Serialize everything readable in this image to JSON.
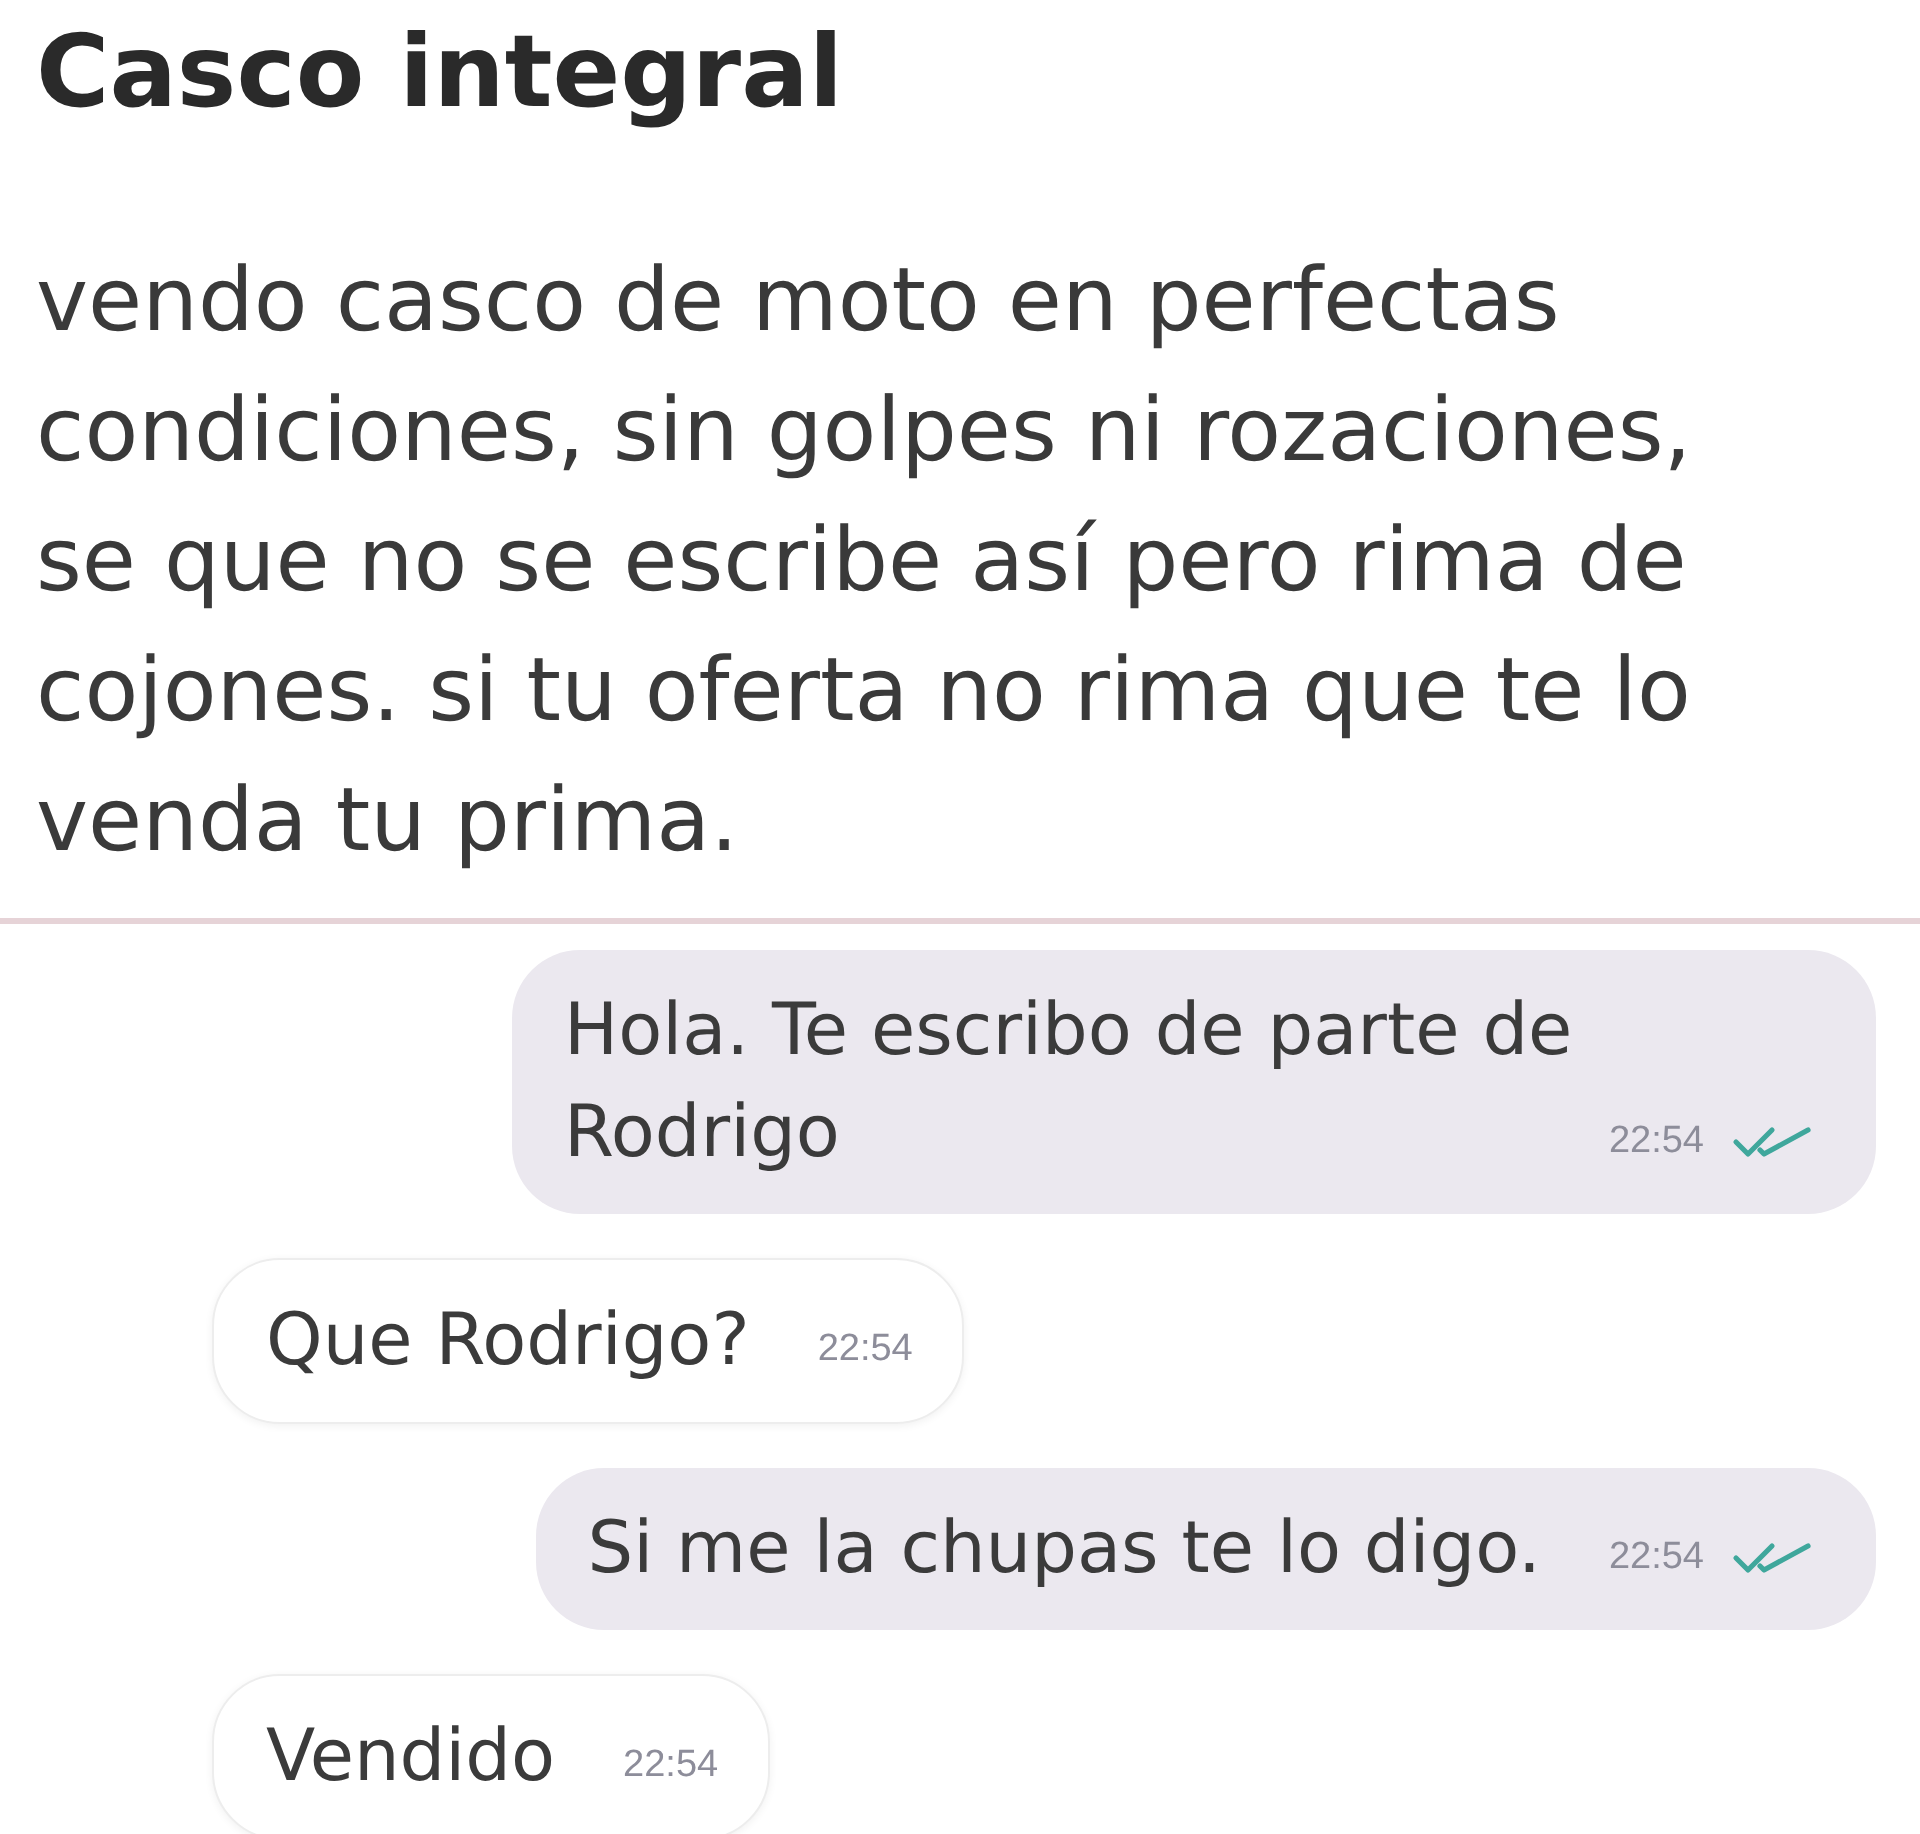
{
  "listing": {
    "title": "Casco integral",
    "description": "vendo casco de moto en perfectas condiciones, sin golpes ni rozaciones, se que no se escribe así pero rima de cojones. si tu oferta no rima que te lo venda tu prima."
  },
  "messages": [
    {
      "kind": "sent",
      "text": "Hola. Te escribo de parte de Rodrigo",
      "time": "22:54",
      "read": true
    },
    {
      "kind": "received",
      "text": "Que Rodrigo?",
      "time": "22:54"
    },
    {
      "kind": "sent",
      "text": "Si me la chupas te lo digo.",
      "time": "22:54",
      "read": true
    },
    {
      "kind": "received",
      "text": "Vendido",
      "time": "22:54"
    }
  ]
}
